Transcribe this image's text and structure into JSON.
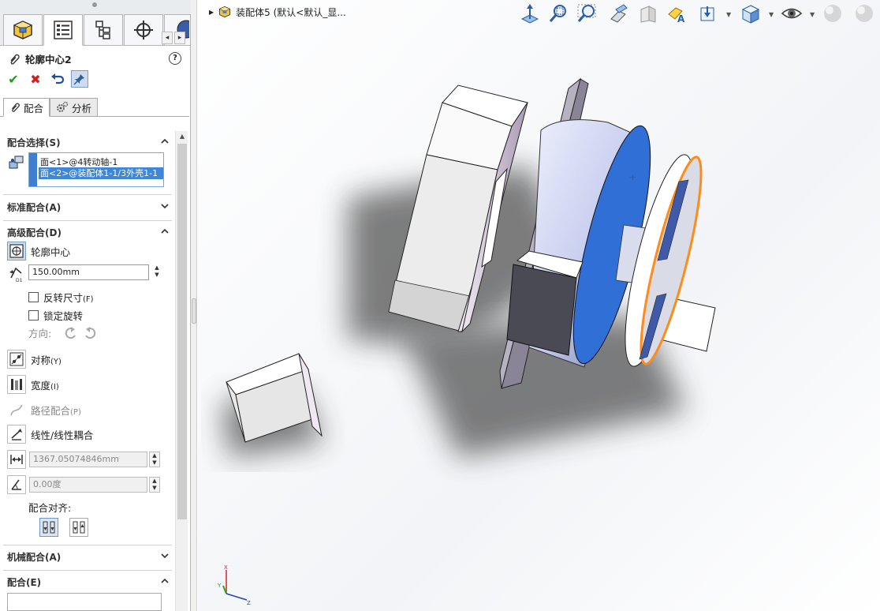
{
  "feature_manager": {
    "tabs": [
      {
        "name": "feature-manager-tree"
      },
      {
        "name": "property-manager"
      },
      {
        "name": "configuration-manager"
      },
      {
        "name": "dimxpert-manager"
      }
    ]
  },
  "property_manager": {
    "title": "轮廓中心2",
    "help": "?",
    "subtabs": {
      "mates": "配合",
      "analysis": "分析"
    },
    "mate_selections": {
      "header": "配合选择(S)",
      "items": [
        "面<1>@4转动轴-1",
        "面<2>@装配体1-1/3外壳1-1"
      ]
    },
    "standard_mates": {
      "header": "标准配合(A)"
    },
    "advanced_mates": {
      "header": "高级配合(D)",
      "profile_center": "轮廓中心",
      "offset_value": "150.00mm",
      "flip_dimension": "反转尺寸",
      "flip_dimension_key": "(F)",
      "lock_rotation": "锁定旋转",
      "orientation_label": "方向:",
      "symmetric": "对称",
      "symmetric_key": "(Y)",
      "width": "宽度",
      "width_key": "(I)",
      "path_mate": "路径配合",
      "path_mate_key": "(P)",
      "linear_coupler": "线性/线性耦合",
      "distance_value": "1367.05074846mm",
      "angle_value": "0.00度",
      "mate_alignment": "配合对齐:"
    },
    "mechanical_mates": {
      "header": "机械配合(A)"
    },
    "mates": {
      "header": "配合(E)"
    }
  },
  "viewport": {
    "breadcrumb": "装配体5  (默认<默认_显...",
    "hud_icons": [
      "view-orientation",
      "zoom-to-fit",
      "zoom-to-area",
      "previous-view",
      "section-view",
      "dynamic-annotation-view",
      "view-orientation-dropdown",
      "display-style",
      "hide-show-items",
      "edit-appearance",
      "apply-scene"
    ],
    "triad": {
      "x": "X",
      "y": "Y",
      "z": "Z"
    }
  },
  "colors": {
    "accent": "#3e86d6",
    "selection_edge": "#ff8c1a",
    "selected_face": "#2f6fd6",
    "check": "#1a9e1a",
    "cancel": "#d41e1e"
  }
}
